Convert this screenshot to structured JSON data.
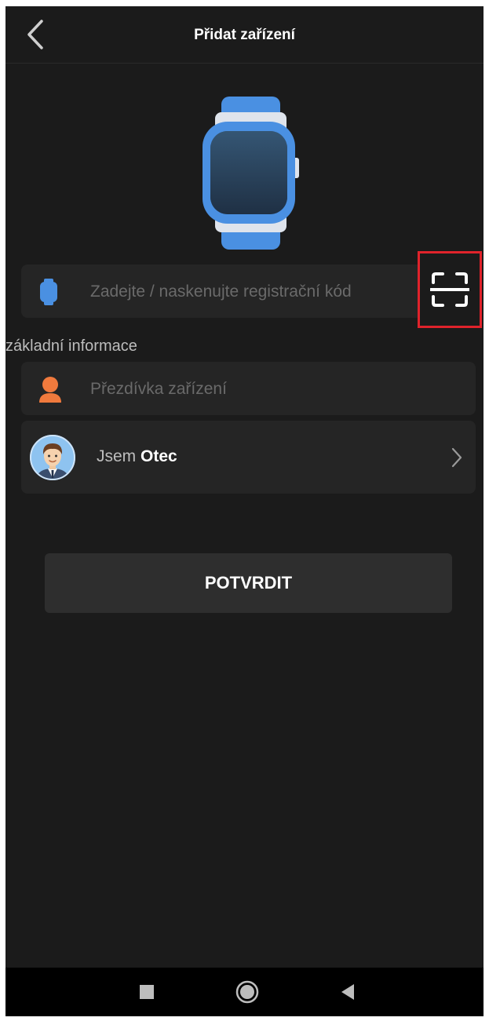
{
  "header": {
    "title": "Přidat zařízení"
  },
  "registration": {
    "placeholder": "Zadejte / naskenujte registrační kód"
  },
  "section": {
    "basic_info_label": "základní informace"
  },
  "nickname": {
    "placeholder": "Přezdívka zařízení"
  },
  "role": {
    "prefix": "Jsem",
    "value": "Otec"
  },
  "confirm": {
    "label": "POTVRDIT"
  },
  "icons": {
    "back": "chevron-left-icon",
    "watch": "smartwatch-icon",
    "scan": "scan-icon",
    "person": "person-icon",
    "avatar": "father-avatar",
    "chevron": "chevron-right-icon"
  },
  "colors": {
    "background": "#1b1b1b",
    "row_background": "#252525",
    "watch_blue": "#4a90e2",
    "person_orange": "#f07a3d",
    "highlight_red": "#e0232b",
    "button_background": "#2e2e2e"
  }
}
